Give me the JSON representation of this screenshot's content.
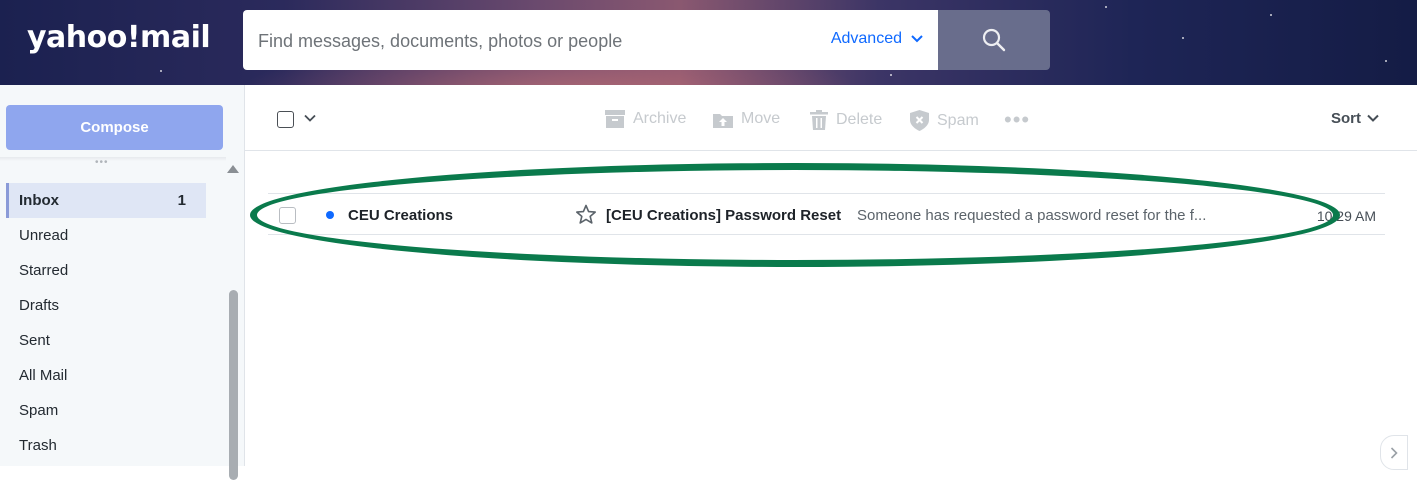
{
  "header": {
    "logo_text": "yahoo!mail",
    "search": {
      "placeholder": "Find messages, documents, photos or people",
      "advanced_label": "Advanced"
    }
  },
  "sidebar": {
    "compose_label": "Compose",
    "folders": [
      {
        "label": "Inbox",
        "count": "1"
      },
      {
        "label": "Unread",
        "count": ""
      },
      {
        "label": "Starred",
        "count": ""
      },
      {
        "label": "Drafts",
        "count": ""
      },
      {
        "label": "Sent",
        "count": ""
      },
      {
        "label": "All Mail",
        "count": ""
      },
      {
        "label": "Spam",
        "count": ""
      },
      {
        "label": "Trash",
        "count": ""
      }
    ]
  },
  "toolbar": {
    "archive_label": "Archive",
    "move_label": "Move",
    "delete_label": "Delete",
    "spam_label": "Spam",
    "sort_label": "Sort"
  },
  "messages": [
    {
      "sender": "CEU Creations",
      "subject": "[CEU Creations] Password Reset",
      "snippet": "Someone has requested a password reset for the f...",
      "time": "10:29 AM",
      "unread": true
    }
  ],
  "colors": {
    "accent": "#0f69ff",
    "compose": "#8fa6ee",
    "highlight": "#0a7a4c"
  }
}
